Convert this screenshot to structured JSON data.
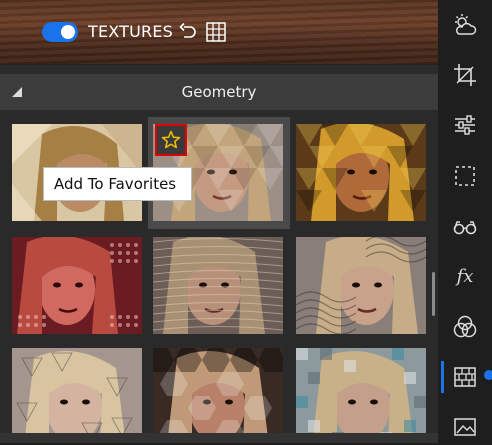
{
  "topbar": {
    "toggle_state": "on",
    "textures_label": "TEXTURES",
    "undo_icon": "undo-icon",
    "grid_icon": "grid-icon"
  },
  "section": {
    "title": "Geometry",
    "collapse_icon": "triangle-icon"
  },
  "favorites": {
    "star_icon": "star-icon",
    "tooltip": "Add To Favorites"
  },
  "thumbnails": [
    {
      "name": "texture-1",
      "tint": "#b89a6a",
      "pattern": "triangles-faded"
    },
    {
      "name": "texture-2",
      "tint": "#8c7a6e",
      "pattern": "triangles-light"
    },
    {
      "name": "texture-3",
      "tint": "#b57a2a",
      "pattern": "triangles-gold"
    },
    {
      "name": "texture-4",
      "tint": "#a8343a",
      "pattern": "dots-red"
    },
    {
      "name": "texture-5",
      "tint": "#7c6a5e",
      "pattern": "lines-wavy"
    },
    {
      "name": "texture-6",
      "tint": "#8a7a70",
      "pattern": "waves"
    },
    {
      "name": "texture-7",
      "tint": "#9a8a80",
      "pattern": "triangles-star"
    },
    {
      "name": "texture-8",
      "tint": "#6a5046",
      "pattern": "hexagons"
    },
    {
      "name": "texture-9",
      "tint": "#7a8a90",
      "pattern": "pixel-blocks"
    }
  ],
  "sidebar": {
    "items": [
      {
        "name": "weather-icon",
        "active": false
      },
      {
        "name": "crop-icon",
        "active": false
      },
      {
        "name": "adjustments-icon",
        "active": false
      },
      {
        "name": "selection-icon",
        "active": false
      },
      {
        "name": "glasses-icon",
        "active": false
      },
      {
        "name": "fx-icon",
        "active": false,
        "label": "fx"
      },
      {
        "name": "blend-circles-icon",
        "active": false
      },
      {
        "name": "texture-brick-icon",
        "active": true
      },
      {
        "name": "image-icon",
        "active": false
      }
    ]
  },
  "colors": {
    "accent": "#1a73e8",
    "highlight_border": "#e00000",
    "star": "#f2c200"
  }
}
